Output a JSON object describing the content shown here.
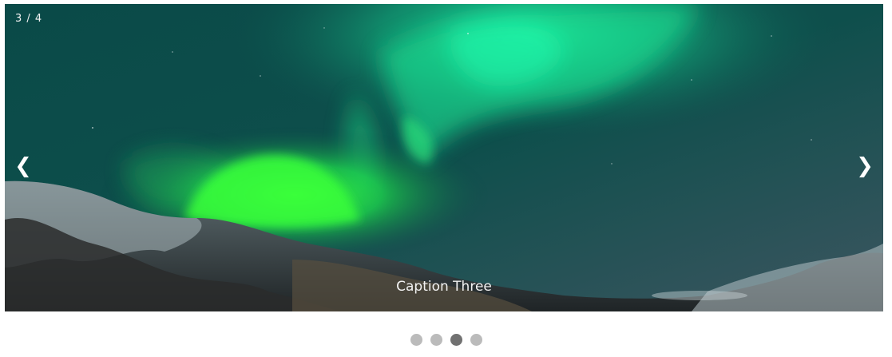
{
  "slideshow": {
    "counter": "3 / 4",
    "prev_label": "❮",
    "next_label": "❯",
    "caption": "Caption Three",
    "image_subject": "aurora borealis over snowy mountains at night",
    "total_slides": 4,
    "active_slide": 3,
    "dots": [
      {
        "index": 1,
        "active": false,
        "color": "#bbbbbb"
      },
      {
        "index": 2,
        "active": false,
        "color": "#bbbbbb"
      },
      {
        "index": 3,
        "active": true,
        "color": "#717171"
      },
      {
        "index": 4,
        "active": false,
        "color": "#bbbbbb"
      }
    ]
  },
  "colors": {
    "sky": "#0b3a3c",
    "aurora": "#27e86a",
    "text": "#f2f2f2"
  }
}
